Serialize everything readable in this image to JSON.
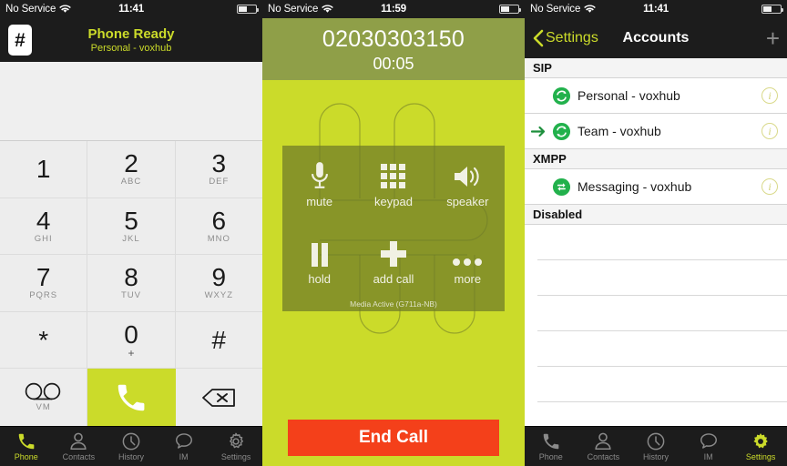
{
  "theme": {
    "accent_green": "#cbdb2a",
    "olive": "#8f9f48",
    "dark": "#1c1c1c",
    "end_call_red": "#f4401a",
    "status_green": "#22b14c"
  },
  "panel_dialer": {
    "statusbar": {
      "carrier": "No Service",
      "time": "11:41",
      "wifi_icon": "wifi-icon",
      "battery_icon": "battery-icon"
    },
    "app_icon": "keypad-hash-icon",
    "app_icon_glyph": "#",
    "title": "Phone Ready",
    "subtitle": "Personal - voxhub",
    "display_value": "",
    "keys": [
      {
        "digit": "1",
        "letters": ""
      },
      {
        "digit": "2",
        "letters": "ABC"
      },
      {
        "digit": "3",
        "letters": "DEF"
      },
      {
        "digit": "4",
        "letters": "GHI"
      },
      {
        "digit": "5",
        "letters": "JKL"
      },
      {
        "digit": "6",
        "letters": "MNO"
      },
      {
        "digit": "7",
        "letters": "PQRS"
      },
      {
        "digit": "8",
        "letters": "TUV"
      },
      {
        "digit": "9",
        "letters": "WXYZ"
      },
      {
        "digit": "*",
        "letters": ""
      },
      {
        "digit": "0",
        "letters": "+"
      },
      {
        "digit": "#",
        "letters": ""
      }
    ],
    "voicemail_label": "VM",
    "voicemail_icon": "voicemail-icon",
    "call_icon": "phone-handset-icon",
    "backspace_icon": "backspace-icon"
  },
  "panel_call": {
    "statusbar": {
      "carrier": "No Service",
      "time": "11:59",
      "wifi_icon": "wifi-icon",
      "battery_icon": "battery-icon"
    },
    "number": "02030303150",
    "duration": "00:05",
    "controls": [
      {
        "label": "mute",
        "icon": "microphone-icon"
      },
      {
        "label": "keypad",
        "icon": "keypad-grid-icon"
      },
      {
        "label": "speaker",
        "icon": "speaker-icon"
      },
      {
        "label": "hold",
        "icon": "pause-icon"
      },
      {
        "label": "add call",
        "icon": "plus-icon"
      },
      {
        "label": "more",
        "icon": "ellipsis-icon"
      }
    ],
    "media_status": "Media Active (G711a-NB)",
    "end_call_label": "End Call"
  },
  "panel_accounts": {
    "statusbar": {
      "carrier": "No Service",
      "time": "11:41",
      "wifi_icon": "wifi-icon",
      "battery_icon": "battery-icon"
    },
    "back_label": "Settings",
    "back_icon": "chevron-left-icon",
    "title": "Accounts",
    "add_label": "+",
    "sections": [
      {
        "header": "SIP",
        "rows": [
          {
            "name": "Personal - voxhub",
            "status_icon": "sip-registered-icon",
            "selected": false,
            "info_icon": "info-icon"
          },
          {
            "name": "Team - voxhub",
            "status_icon": "sip-registered-icon",
            "selected": true,
            "info_icon": "info-icon"
          }
        ]
      },
      {
        "header": "XMPP",
        "rows": [
          {
            "name": "Messaging - voxhub",
            "status_icon": "xmpp-connected-icon",
            "selected": false,
            "info_icon": "info-icon"
          }
        ]
      },
      {
        "header": "Disabled",
        "rows": []
      }
    ]
  },
  "tabbar": {
    "items": [
      {
        "label": "Phone",
        "icon": "phone-handset-icon"
      },
      {
        "label": "Contacts",
        "icon": "person-icon"
      },
      {
        "label": "History",
        "icon": "clock-icon"
      },
      {
        "label": "IM",
        "icon": "chat-bubble-icon"
      },
      {
        "label": "Settings",
        "icon": "gear-icon"
      }
    ],
    "active_dialer": "Phone",
    "active_accounts": "Settings"
  }
}
